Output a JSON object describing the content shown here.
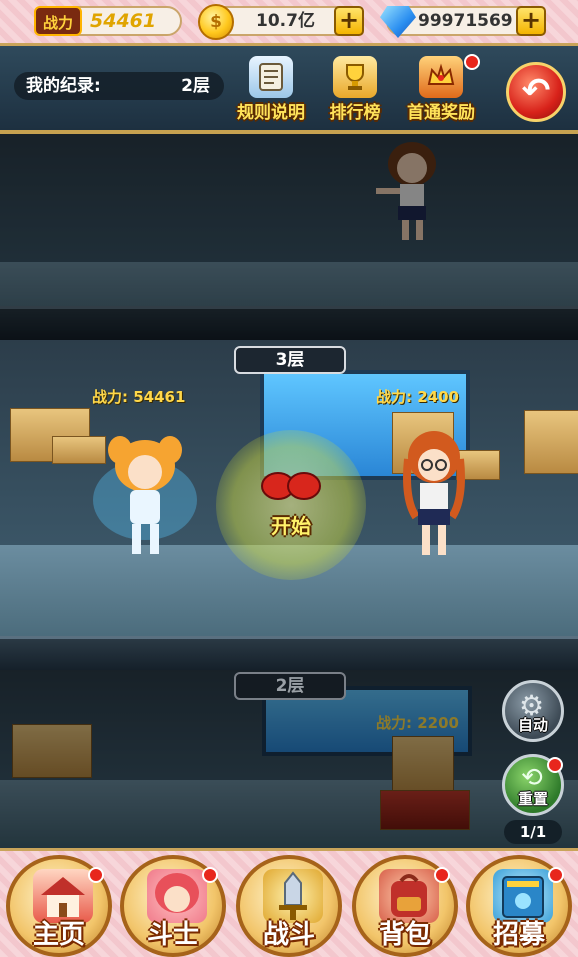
{
  "topbar": {
    "power_icon_label": "战力",
    "power_value": "54461",
    "gold_value": "10.7亿",
    "gem_value": "99971569",
    "plus_label": "+"
  },
  "header": {
    "record_label": "我的纪录:",
    "record_value": "2层",
    "buttons": [
      {
        "label": "规则说明",
        "icon": "scroll-icon",
        "badge": false
      },
      {
        "label": "排行榜",
        "icon": "trophy-icon",
        "badge": false
      },
      {
        "label": "首通奖励",
        "icon": "reward-crown-icon",
        "badge": true
      }
    ],
    "back_icon": "back-arrow-icon"
  },
  "floors": {
    "current": {
      "label": "3层",
      "player_power": "战力: 54461",
      "enemy_power": "战力: 2400"
    },
    "lower": {
      "label": "2层",
      "enemy_power": "战力: 2200"
    }
  },
  "start_label": "开始",
  "side": {
    "auto_label": "自动",
    "reset_label": "重置",
    "counter": "1/1"
  },
  "nav": [
    {
      "label": "主页",
      "icon": "home-icon",
      "badge": true
    },
    {
      "label": "斗士",
      "icon": "fighter-icon",
      "badge": true
    },
    {
      "label": "战斗",
      "icon": "battle-sword-icon",
      "badge": false
    },
    {
      "label": "背包",
      "icon": "backpack-icon",
      "badge": true
    },
    {
      "label": "招募",
      "icon": "recruit-book-icon",
      "badge": true
    }
  ],
  "colors": {
    "accent_gold": "#c9a45a",
    "power_yellow": "#ffd84a",
    "badge_red": "#e8261c"
  }
}
